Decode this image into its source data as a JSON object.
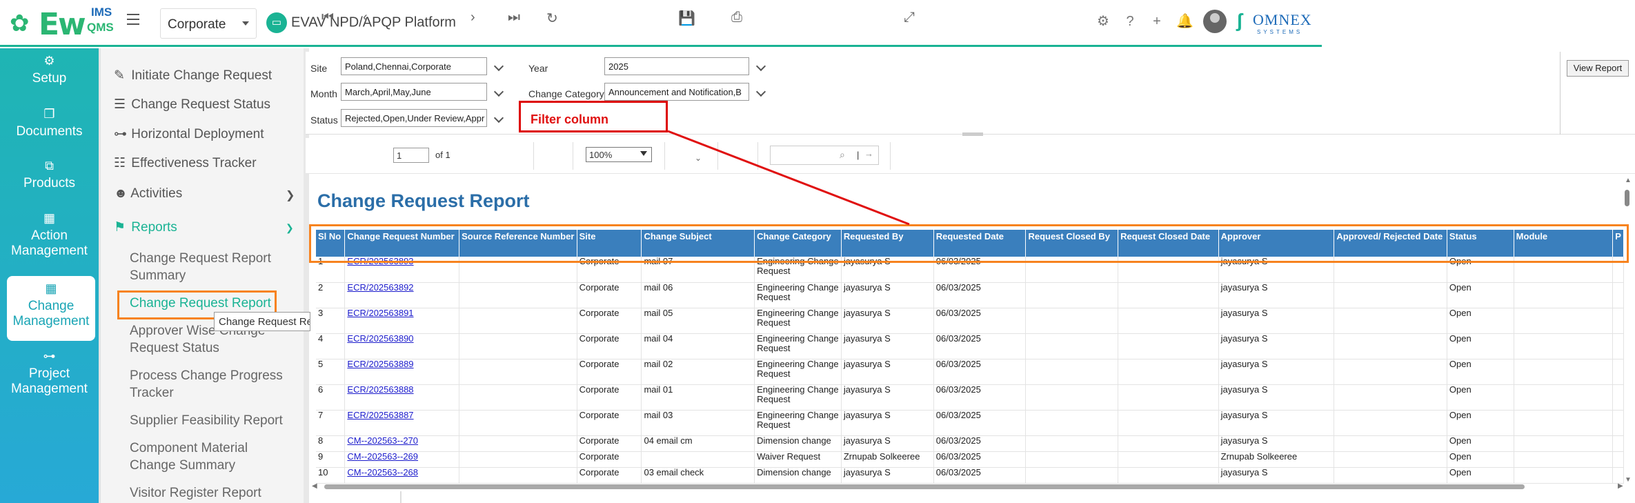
{
  "header": {
    "logo_text": "Ew",
    "logo_ims": "IMS",
    "logo_qms": "QMS",
    "site_select": "Corporate",
    "platform_title": "EVAV NPD/APQP Platform",
    "omnex_logo": "OMNEX",
    "omnex_sub": "SYSTEMS",
    "icons": [
      "gear-icon",
      "help-icon",
      "plus-icon",
      "bell-icon",
      "user-avatar"
    ]
  },
  "leftnav": [
    {
      "label": "Setup",
      "icon": "gears-icon"
    },
    {
      "label": "Documents",
      "icon": "documents-icon"
    },
    {
      "label": "Products",
      "icon": "products-icon"
    },
    {
      "label": "Action Management",
      "icon": "building-icon"
    },
    {
      "label": "Change Management",
      "icon": "building-icon"
    },
    {
      "label": "Project Management",
      "icon": "hierarchy-icon"
    }
  ],
  "submenu": {
    "items": [
      {
        "label": "Initiate Change Request",
        "icon": "edit-icon"
      },
      {
        "label": "Change Request Status",
        "icon": "sliders-icon"
      },
      {
        "label": "Horizontal Deployment",
        "icon": "hierarchy-icon"
      },
      {
        "label": "Effectiveness Tracker",
        "icon": "checklist-icon"
      },
      {
        "label": "Activities",
        "icon": "user-check-icon"
      },
      {
        "label": "Reports",
        "icon": "flag-icon"
      }
    ],
    "reports_children": [
      "Change Request Report Summary",
      "Change Request Report",
      "Approver Wise Change Request Status",
      "Process Change Progress Tracker",
      "Supplier Feasibility Report",
      "Component Material Change Summary",
      "Visitor Register Report"
    ],
    "tooltip": "Change Request Report"
  },
  "filters": {
    "site_label": "Site",
    "site_value": "Poland,Chennai,Corporate",
    "year_label": "Year",
    "year_value": "2025",
    "month_label": "Month",
    "month_value": "March,April,May,June",
    "category_label": "Change Category",
    "category_value": "Announcement and Notification,B",
    "status_label": "Status",
    "status_value": "Rejected,Open,Under Review,Appr",
    "view_report": "View Report",
    "callout": "Filter column"
  },
  "toolbar": {
    "page_value": "1",
    "page_of": "of 1",
    "zoom": "100%",
    "find_sep": "|"
  },
  "report": {
    "title": "Change Request Report",
    "columns": [
      "Sl No",
      "Change Request Number",
      "Source Reference Number",
      "Site",
      "Change Subject",
      "Change Category",
      "Requested By",
      "Requested Date",
      "Request Closed By",
      "Request Closed Date",
      "Approver",
      "Approved/ Rejected Date",
      "Status",
      "Module",
      "P"
    ],
    "rows": [
      {
        "sl": "1",
        "num": "ECR/202563893",
        "src": "",
        "site": "Corporate",
        "subject": "mail 07",
        "category": "Engineering Change Request",
        "by": "jayasurya S",
        "date": "06/03/2025",
        "closed_by": "",
        "closed_date": "",
        "approver": "jayasurya S",
        "approved": "",
        "status": "Open",
        "module": ""
      },
      {
        "sl": "2",
        "num": "ECR/202563892",
        "src": "",
        "site": "Corporate",
        "subject": "mail 06",
        "category": "Engineering Change Request",
        "by": "jayasurya S",
        "date": "06/03/2025",
        "closed_by": "",
        "closed_date": "",
        "approver": "jayasurya S",
        "approved": "",
        "status": "Open",
        "module": ""
      },
      {
        "sl": "3",
        "num": "ECR/202563891",
        "src": "",
        "site": "Corporate",
        "subject": "mail 05",
        "category": "Engineering Change Request",
        "by": "jayasurya S",
        "date": "06/03/2025",
        "closed_by": "",
        "closed_date": "",
        "approver": "jayasurya S",
        "approved": "",
        "status": "Open",
        "module": ""
      },
      {
        "sl": "4",
        "num": "ECR/202563890",
        "src": "",
        "site": "Corporate",
        "subject": "mail 04",
        "category": "Engineering Change Request",
        "by": "jayasurya S",
        "date": "06/03/2025",
        "closed_by": "",
        "closed_date": "",
        "approver": "jayasurya S",
        "approved": "",
        "status": "Open",
        "module": ""
      },
      {
        "sl": "5",
        "num": "ECR/202563889",
        "src": "",
        "site": "Corporate",
        "subject": "mail 02",
        "category": "Engineering Change Request",
        "by": "jayasurya S",
        "date": "06/03/2025",
        "closed_by": "",
        "closed_date": "",
        "approver": "jayasurya S",
        "approved": "",
        "status": "Open",
        "module": ""
      },
      {
        "sl": "6",
        "num": "ECR/202563888",
        "src": "",
        "site": "Corporate",
        "subject": "mail 01",
        "category": "Engineering Change Request",
        "by": "jayasurya S",
        "date": "06/03/2025",
        "closed_by": "",
        "closed_date": "",
        "approver": "jayasurya S",
        "approved": "",
        "status": "Open",
        "module": ""
      },
      {
        "sl": "7",
        "num": "ECR/202563887",
        "src": "",
        "site": "Corporate",
        "subject": "mail 03",
        "category": "Engineering Change Request",
        "by": "jayasurya S",
        "date": "06/03/2025",
        "closed_by": "",
        "closed_date": "",
        "approver": "jayasurya S",
        "approved": "",
        "status": "Open",
        "module": ""
      },
      {
        "sl": "8",
        "num": "CM--202563--270",
        "src": "",
        "site": "Corporate",
        "subject": "04 email cm",
        "category": "Dimension change",
        "by": "jayasurya S",
        "date": "06/03/2025",
        "closed_by": "",
        "closed_date": "",
        "approver": "jayasurya S",
        "approved": "",
        "status": "Open",
        "module": ""
      },
      {
        "sl": "9",
        "num": "CM--202563--269",
        "src": "",
        "site": "Corporate",
        "subject": "",
        "category": "Waiver Request",
        "by": "Zrnupab  Solkeeree",
        "date": "06/03/2025",
        "closed_by": "",
        "closed_date": "",
        "approver": "Zrnupab  Solkeeree",
        "approved": "",
        "status": "Open",
        "module": ""
      },
      {
        "sl": "10",
        "num": "CM--202563--268",
        "src": "",
        "site": "Corporate",
        "subject": "03 email check",
        "category": "Dimension change",
        "by": "jayasurya S",
        "date": "06/03/2025",
        "closed_by": "",
        "closed_date": "",
        "approver": "jayasurya S",
        "approved": "",
        "status": "Open",
        "module": ""
      }
    ]
  },
  "colors": {
    "accent": "#1ab394",
    "header_bg": "#3a7fbd",
    "title": "#2b6ea8",
    "highlight": "#f7831f",
    "callout": "#e01010"
  }
}
